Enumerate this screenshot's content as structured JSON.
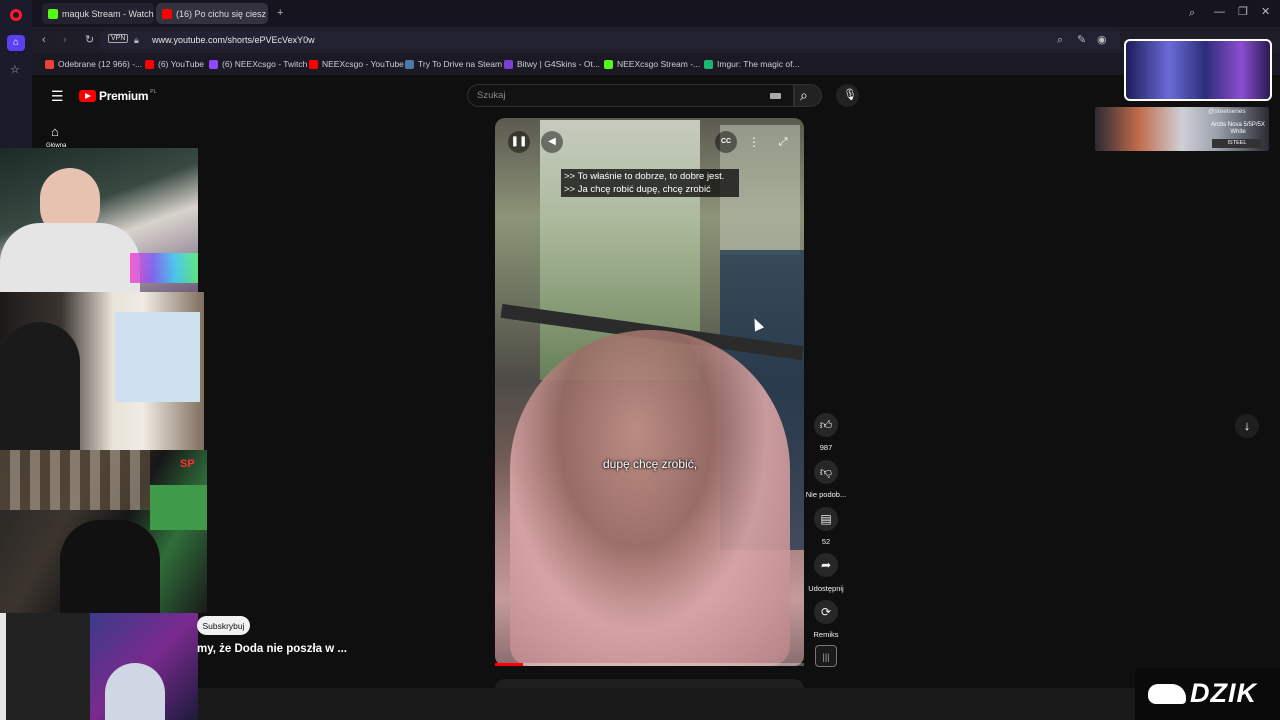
{
  "browser": {
    "tabs": [
      {
        "label": "maquk Stream - Watch Li",
        "active": false,
        "favicon_color": "#53fc18"
      },
      {
        "label": "(16) Po cichu się ciesz",
        "active": true,
        "favicon_color": "#ff0000"
      }
    ],
    "vpn_label": "VPN",
    "url": "www.youtube.com/shorts/ePVEcVexY0w",
    "bookmarks": [
      {
        "label": "Odebrane (12 966) -...",
        "color": "#ea4335"
      },
      {
        "label": "(6) YouTube",
        "color": "#ff0000"
      },
      {
        "label": "(6) NEEXcsgo - Twitch",
        "color": "#9146ff"
      },
      {
        "label": "NEEXcsgo - YouTube",
        "color": "#ff0000"
      },
      {
        "label": "Try To Drive na Steam",
        "color": "#1b2838"
      },
      {
        "label": "Bitwy | G4Skins - Ot...",
        "color": "#7b3fd1"
      },
      {
        "label": "NEEXcsgo Stream -...",
        "color": "#53fc18"
      },
      {
        "label": "Imgur: The magic of...",
        "color": "#1bb76e"
      }
    ]
  },
  "youtube": {
    "logo_text": "Premium",
    "logo_badge": "PL",
    "home_label": "Główna",
    "search_placeholder": "Szukaj",
    "captions": {
      "line1": ">> To właśnie to dobrze, to dobre jest.",
      "line2": ">> Ja chcę robić dupę, chcę zrobić",
      "burned_in": "dupę chcę zrobić,"
    },
    "actions": {
      "like_count": "987",
      "dislike_label": "Nie podob...",
      "comments_count": "52",
      "share_label": "Udostępnij",
      "remix_label": "Remiks"
    },
    "subscribe_label": "Subskrybuj",
    "next_title": "my, że Doda nie poszła w ..."
  },
  "overlay": {
    "ad_brand": "@steelseries",
    "ad_model": "Arctis Nova 5/5P/5X White",
    "ad_cta": "ISTEEL",
    "streamer_logo": "DZIK",
    "cam_tag": "SP"
  },
  "icons": [
    "opera-logo-icon",
    "home-icon",
    "star-icon",
    "back-icon",
    "forward-icon",
    "reload-icon",
    "lock-icon",
    "search-icon",
    "mic-icon",
    "keyboard-icon",
    "pause-icon",
    "volume-icon",
    "cc-icon",
    "more-icon",
    "fullscreen-icon",
    "like-icon",
    "dislike-icon",
    "comment-icon",
    "share-icon",
    "remix-icon",
    "down-arrow-icon",
    "menu-icon"
  ],
  "colors": {
    "youtube_red": "#ff0000",
    "background": "#0f0f0f",
    "opera_red": "#ff1b2d"
  }
}
